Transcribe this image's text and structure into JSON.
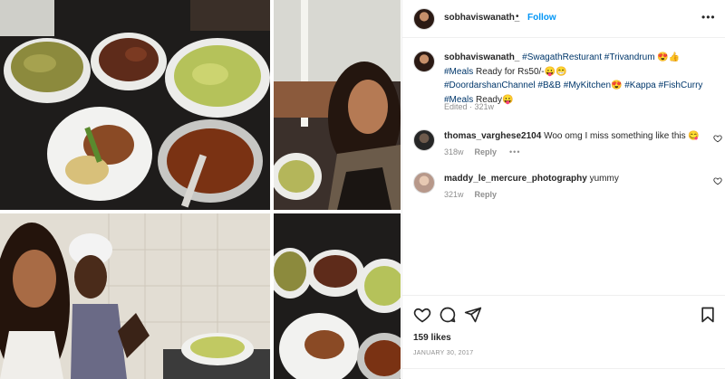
{
  "post": {
    "username": "sobhaviswanath_",
    "separator": "•",
    "follow_label": "Follow",
    "more_label": "•••"
  },
  "caption": {
    "username": "sobhaviswanath_",
    "hashtags_line1": [
      "#SwagathResturant",
      "#Trivandrum"
    ],
    "emoji_line1": "😍👍",
    "meals_tag": "#Meals",
    "meals_text": "Ready for Rs50/-😛😁",
    "hashtags_line3": [
      "#DoordarshanChannel",
      "#B&B",
      "#MyKitchen"
    ],
    "emoji_line3": "😍",
    "hashtags_line3b": [
      "#Kappa",
      "#FishCurry"
    ],
    "meals_tag2": "#Meals",
    "closing_text": "Ready😛",
    "edited": "Edited · 321w"
  },
  "comments": [
    {
      "username": "thomas_varghese2104",
      "text": "Woo omg I miss something like this 😋",
      "age": "318w",
      "reply_label": "Reply",
      "more_label": "•••"
    },
    {
      "username": "maddy_le_mercure_photography",
      "text": "yummy",
      "age": "321w",
      "reply_label": "Reply"
    }
  ],
  "actions": {
    "like_icon": "heart-icon",
    "comment_icon": "comment-icon",
    "share_icon": "send-icon",
    "save_icon": "bookmark-icon"
  },
  "likes_text": "159 likes",
  "date_text": "JANUARY 30, 2017",
  "colors": {
    "link": "#0095f6",
    "hashtag": "#00376b",
    "muted": "#8e8e8e",
    "text": "#262626"
  }
}
